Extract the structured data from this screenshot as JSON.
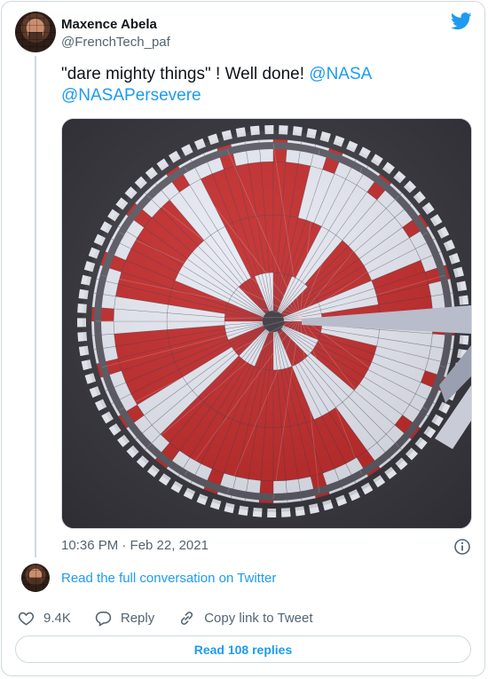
{
  "author": {
    "name": "Maxence Abela",
    "handle": "@FrenchTech_paf"
  },
  "tweet": {
    "text_prefix": "\"dare mighty things\" ! Well done! ",
    "mention_1": "@NASA",
    "mention_2": "@NASAPersevere",
    "media_alt": "parachute-image",
    "timestamp": "10:36 PM · Feb 22, 2021"
  },
  "conversation_link": "Read the full conversation on Twitter",
  "actions": {
    "like_count": "9.4K",
    "reply_label": "Reply",
    "copy_label": "Copy link to Tweet"
  },
  "read_replies_label": "Read 108 replies",
  "colors": {
    "brand_blue": "#1d9bf0",
    "text_primary": "#0f1419",
    "text_secondary": "#536471",
    "border": "#cfd9de",
    "parachute_red": "#c22a2a",
    "parachute_white": "#e6e9f2"
  }
}
